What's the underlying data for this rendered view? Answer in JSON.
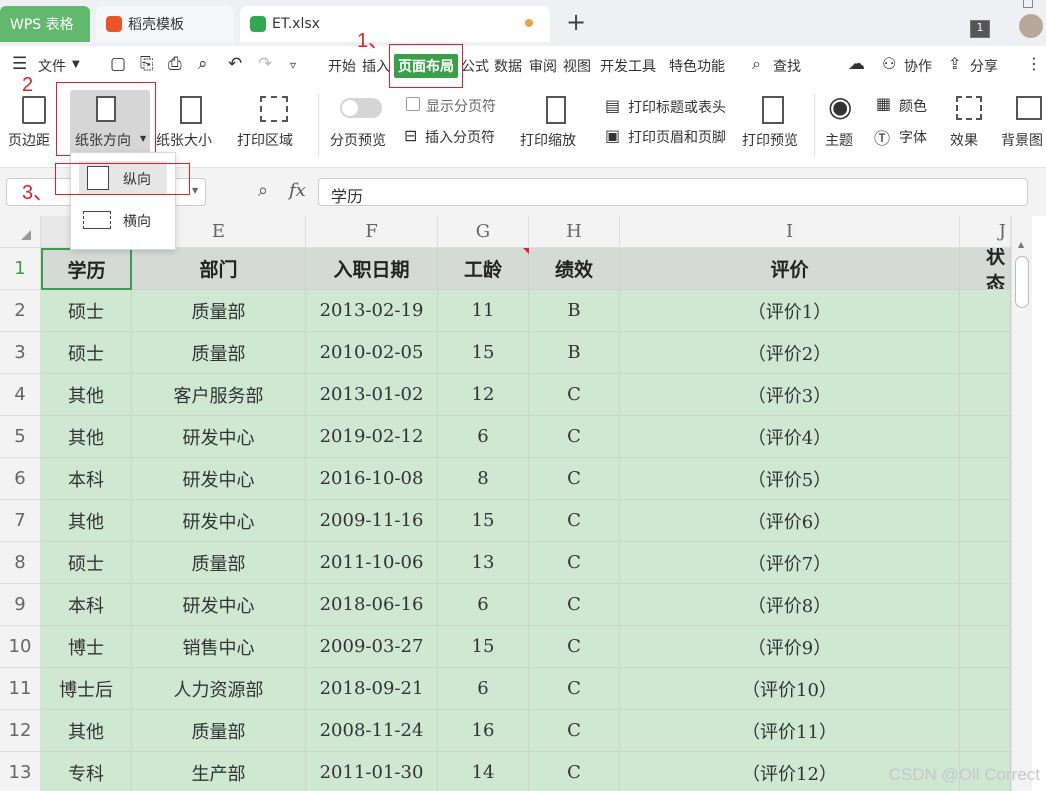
{
  "tabs": {
    "wps": "WPS 表格",
    "template": "稻壳模板",
    "file": "ET.xlsx",
    "new_tab": "+",
    "window_count": "1"
  },
  "menu": {
    "file": "文件",
    "items": [
      "开始",
      "插入",
      "页面布局",
      "公式",
      "数据",
      "审阅",
      "视图",
      "开发工具",
      "特色功能"
    ],
    "search": "查找",
    "collab": "协作",
    "share": "分享"
  },
  "ribbon": {
    "margin": "页边距",
    "orientation": "纸张方向",
    "size": "纸张大小",
    "print_area": "打印区域",
    "page_preview": "分页预览",
    "show_breaks": "显示分页符",
    "insert_break": "插入分页符",
    "print_scale": "打印缩放",
    "print_titles": "打印标题或表头",
    "print_header_footer": "打印页眉和页脚",
    "print_preview": "打印预览",
    "theme": "主题",
    "color": "颜色",
    "font": "字体",
    "effect": "效果",
    "background": "背景图"
  },
  "dropdown": {
    "portrait": "纵向",
    "landscape": "横向"
  },
  "annotations": {
    "step1": "1、",
    "step2": "2",
    "step3": "3、"
  },
  "formula_bar": {
    "fx": "fx",
    "value": "学历"
  },
  "columns": [
    "E",
    "F",
    "G",
    "H",
    "I",
    "J"
  ],
  "header_row": [
    "学历",
    "部门",
    "入职日期",
    "工龄",
    "绩效",
    "评价",
    "状态"
  ],
  "rows": [
    {
      "n": "2",
      "cells": [
        "硕士",
        "质量部",
        "2013-02-19",
        "11",
        "B",
        "（评价1）"
      ]
    },
    {
      "n": "3",
      "cells": [
        "硕士",
        "质量部",
        "2010-02-05",
        "15",
        "B",
        "（评价2）"
      ]
    },
    {
      "n": "4",
      "cells": [
        "其他",
        "客户服务部",
        "2013-01-02",
        "12",
        "C",
        "（评价3）"
      ]
    },
    {
      "n": "5",
      "cells": [
        "其他",
        "研发中心",
        "2019-02-12",
        "6",
        "C",
        "（评价4）"
      ]
    },
    {
      "n": "6",
      "cells": [
        "本科",
        "研发中心",
        "2016-10-08",
        "8",
        "C",
        "（评价5）"
      ]
    },
    {
      "n": "7",
      "cells": [
        "其他",
        "研发中心",
        "2009-11-16",
        "15",
        "C",
        "（评价6）"
      ]
    },
    {
      "n": "8",
      "cells": [
        "硕士",
        "质量部",
        "2011-10-06",
        "13",
        "C",
        "（评价7）"
      ]
    },
    {
      "n": "9",
      "cells": [
        "本科",
        "研发中心",
        "2018-06-16",
        "6",
        "C",
        "（评价8）"
      ]
    },
    {
      "n": "10",
      "cells": [
        "博士",
        "销售中心",
        "2009-03-27",
        "15",
        "C",
        "（评价9）"
      ]
    },
    {
      "n": "11",
      "cells": [
        "博士后",
        "人力资源部",
        "2018-09-21",
        "6",
        "C",
        "（评价10）"
      ]
    },
    {
      "n": "12",
      "cells": [
        "其他",
        "质量部",
        "2008-11-24",
        "16",
        "C",
        "（评价11）"
      ]
    },
    {
      "n": "13",
      "cells": [
        "专科",
        "生产部",
        "2011-01-30",
        "14",
        "C",
        "（评价12）"
      ]
    }
  ],
  "watermark": "CSDN @Oll Correct",
  "colors": {
    "accent": "#3b9f4a",
    "cell_bg": "#cfe8d2",
    "annotation": "#e0202a"
  }
}
